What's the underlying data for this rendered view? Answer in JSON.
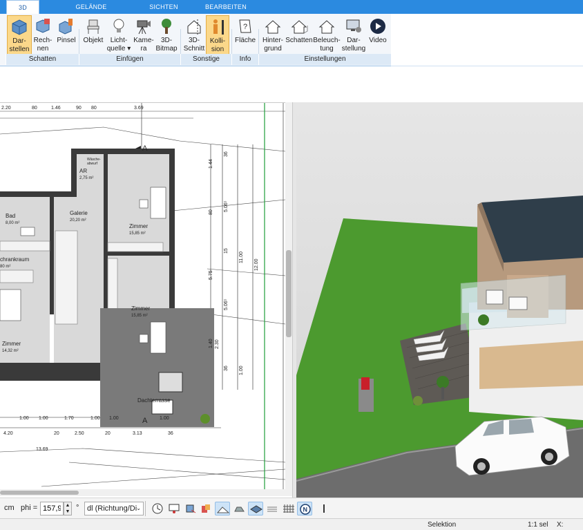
{
  "tabs": [
    {
      "label": "3D"
    },
    {
      "label": "GELÄNDE"
    },
    {
      "label": "SICHTEN"
    },
    {
      "label": "BEARBEITEN"
    }
  ],
  "ribbon": {
    "buttons": [
      {
        "label1": "Dar-",
        "label2": "stellen",
        "icon": "cube-icon"
      },
      {
        "label1": "Rech-",
        "label2": "nen",
        "icon": "cube-calc-icon"
      },
      {
        "label1": "Pinsel",
        "label2": "",
        "icon": "brush-cube-icon"
      },
      {
        "label1": "Objekt",
        "label2": "",
        "icon": "chair-icon"
      },
      {
        "label1": "Licht-",
        "label2": "quelle ▾",
        "icon": "lightbulb-icon"
      },
      {
        "label1": "Kame-",
        "label2": "ra",
        "icon": "camera-icon"
      },
      {
        "label1": "3D-",
        "label2": "Bitmap",
        "icon": "tree-icon"
      },
      {
        "label1": "3D-",
        "label2": "Schnitt",
        "icon": "section-house-icon"
      },
      {
        "label1": "Kolli-",
        "label2": "sion",
        "icon": "person-collision-icon"
      },
      {
        "label1": "Fläche",
        "label2": "",
        "icon": "area-question-icon"
      },
      {
        "label1": "Hinter-",
        "label2": "grund",
        "icon": "house-background-icon"
      },
      {
        "label1": "Schatten",
        "label2": "",
        "icon": "house-shadow-icon"
      },
      {
        "label1": "Beleuch-",
        "label2": "tung",
        "icon": "house-light-icon"
      },
      {
        "label1": "Dar-",
        "label2": "stellung",
        "icon": "monitor-gear-icon"
      },
      {
        "label1": "Video",
        "label2": "",
        "icon": "play-icon"
      }
    ],
    "groups": [
      "Schatten",
      "Einfügen",
      "Sonstige",
      "Info",
      "Einstellungen"
    ]
  },
  "plan": {
    "top_dims": [
      "2.20",
      "80",
      "1.46",
      "90",
      "80",
      "3.69"
    ],
    "bottom_dims": [
      "1.00",
      "1.00",
      "1.70",
      "1.00",
      "1.00",
      "1.00"
    ],
    "bottom_dims2": [
      "4.20",
      "20",
      "2.50",
      "20",
      "3.13",
      "36"
    ],
    "bottom_dim3": "13.69",
    "side_dims": [
      "36",
      "1.44",
      "80",
      "5.06⁵",
      "15",
      "11.00",
      "12.00",
      "5.75",
      "5.06⁵",
      "1.40",
      "2.30",
      "36",
      "1.00"
    ],
    "section_marker": "A",
    "rooms": [
      {
        "name": "AR",
        "area": "2,75 m²"
      },
      {
        "name": "Bad",
        "area": "8,00 m²"
      },
      {
        "name": "Galerie",
        "area": "20,20 m²"
      },
      {
        "name": "Zimmer",
        "area": "15,85 m²"
      },
      {
        "name": "chrankraum",
        "area": "80 m²"
      },
      {
        "name": "Zimmer",
        "area": "15,85 m²"
      },
      {
        "name": "Zimmer",
        "area": "14,32 m²"
      },
      {
        "name": "Dachterrasse",
        "area": ""
      },
      {
        "name": "Wäsche-",
        "area": "abwurf"
      }
    ]
  },
  "toolbar": {
    "unit": "cm",
    "phi_label": "phi =",
    "phi_value": "157,90",
    "degree": "°",
    "dl_select": "dl (Richtung/Di"
  },
  "status": {
    "mode": "Selektion",
    "scale": "1:1 sel",
    "coord_label": "X:"
  },
  "colors": {
    "tab_blue": "#2b8ae0",
    "selected_button": "#fbd88a",
    "grass": "#4c9a2f",
    "road": "#6d6d6d"
  }
}
